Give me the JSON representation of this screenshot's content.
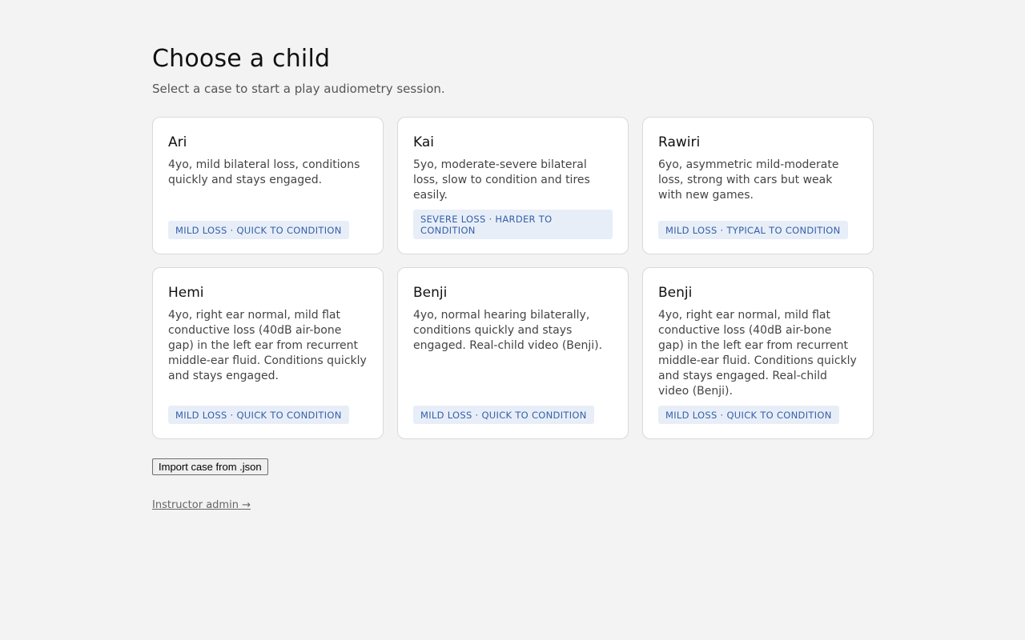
{
  "header": {
    "title": "Choose a child",
    "subtitle": "Select a case to start a play audiometry session."
  },
  "cases": [
    {
      "name": "Ari",
      "description": "4yo, mild bilateral loss, conditions quickly and stays engaged.",
      "tag": "MILD LOSS · QUICK TO CONDITION"
    },
    {
      "name": "Kai",
      "description": "5yo, moderate-severe bilateral loss, slow to condition and tires easily.",
      "tag": "SEVERE LOSS · HARDER TO CONDITION"
    },
    {
      "name": "Rawiri",
      "description": "6yo, asymmetric mild-moderate loss, strong with cars but weak with new games.",
      "tag": "MILD LOSS · TYPICAL TO CONDITION"
    },
    {
      "name": "Hemi",
      "description": "4yo, right ear normal, mild flat conductive loss (40dB air-bone gap) in the left ear from recurrent middle-ear fluid. Conditions quickly and stays engaged.",
      "tag": "MILD LOSS · QUICK TO CONDITION"
    },
    {
      "name": "Benji",
      "description": "4yo, normal hearing bilaterally, conditions quickly and stays engaged. Real-child video (Benji).",
      "tag": "MILD LOSS · QUICK TO CONDITION"
    },
    {
      "name": "Benji",
      "description": "4yo, right ear normal, mild flat conductive loss (40dB air-bone gap) in the left ear from recurrent middle-ear fluid. Conditions quickly and stays engaged. Real-child video (Benji).",
      "tag": "MILD LOSS · QUICK TO CONDITION"
    }
  ],
  "actions": {
    "import_label": "Import case from .json",
    "admin_link": "Instructor admin →"
  },
  "colors": {
    "background": "#f3f3f3",
    "card": "#ffffff",
    "tag_bg": "#e8eef8",
    "tag_text": "#3560a8"
  }
}
